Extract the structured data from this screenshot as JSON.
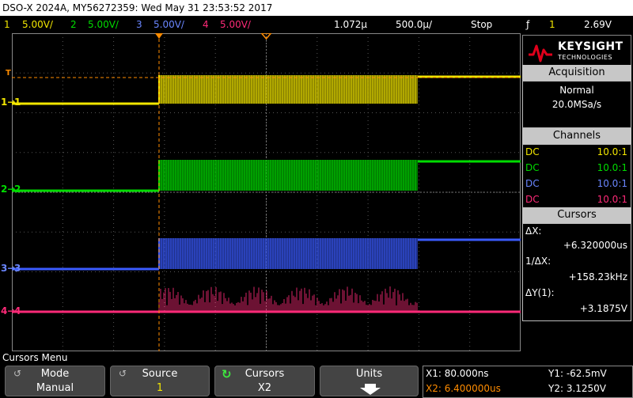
{
  "title": "DSO-X 2024A, MY56272359: Wed May 31 23:53:52 2017",
  "status": {
    "ch1_num": "1",
    "ch1_scale": "5.00V/",
    "ch2_num": "2",
    "ch2_scale": "5.00V/",
    "ch3_num": "3",
    "ch3_scale": "5.00V/",
    "ch4_num": "4",
    "ch4_scale": "5.00V/",
    "time_ref": "1.072µ",
    "timebase": "500.0µ/",
    "run_state": "Stop",
    "trig_channel": "1",
    "trig_level": "2.69V"
  },
  "colors": {
    "ch1": "#f2e600",
    "ch2": "#00dc00",
    "ch3": "#3b5bff",
    "ch4": "#ff2a78",
    "accent": "#ff8c00"
  },
  "brand": {
    "name": "KEYSIGHT",
    "sub": "TECHNOLOGIES"
  },
  "acquisition": {
    "header": "Acquisition",
    "mode": "Normal",
    "rate": "20.0MSa/s"
  },
  "channels": {
    "header": "Channels",
    "rows": [
      {
        "coupling": "DC",
        "probe": "10.0:1"
      },
      {
        "coupling": "DC",
        "probe": "10.0:1"
      },
      {
        "coupling": "DC",
        "probe": "10.0:1"
      },
      {
        "coupling": "DC",
        "probe": "10.0:1"
      }
    ]
  },
  "cursors": {
    "header": "Cursors",
    "dx_label": "ΔX:",
    "dx_value": "+6.320000us",
    "inv_dx_label": "1/ΔX:",
    "inv_dx_value": "+158.23kHz",
    "dy_label": "ΔY(1):",
    "dy_value": "+3.1875V"
  },
  "menu_title": "Cursors Menu",
  "softkeys": [
    {
      "top": "Mode",
      "bottom": "Manual"
    },
    {
      "top": "Source",
      "bottom": "1"
    },
    {
      "top": "Cursors",
      "bottom": "X2"
    },
    {
      "top": "Units",
      "bottom": ""
    }
  ],
  "cursor_readout": {
    "x1": "X1: 80.000ns",
    "x2": "X2: 6.400000us",
    "y1": "Y1: -62.5mV",
    "y2": "Y2: 3.1250V"
  },
  "markers": {
    "ch1": "1",
    "ch2": "2",
    "ch3": "3",
    "ch4": "4",
    "trig": "T"
  }
}
